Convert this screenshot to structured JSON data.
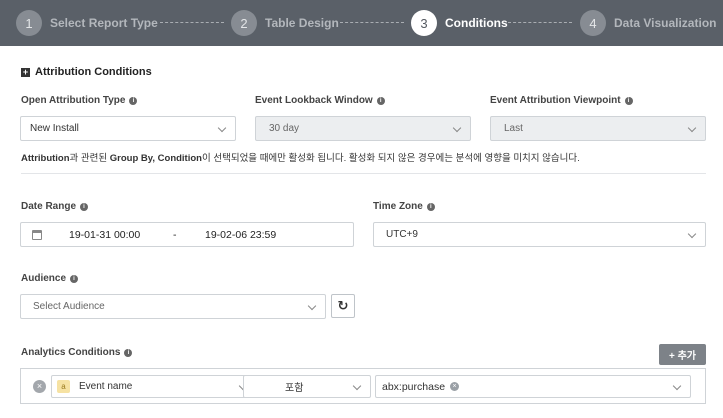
{
  "stepper": {
    "steps": [
      {
        "num": "1",
        "label": "Select Report Type"
      },
      {
        "num": "2",
        "label": "Table Design"
      },
      {
        "num": "3",
        "label": "Conditions"
      },
      {
        "num": "4",
        "label": "Data Visualization"
      }
    ],
    "active_step": 3
  },
  "section": {
    "icon": "plus-square-icon",
    "title": "Attribution Conditions"
  },
  "attribution": {
    "open_type": {
      "label": "Open Attribution Type",
      "value": "New Install"
    },
    "lookback": {
      "label": "Event Lookback Window",
      "value": "30 day"
    },
    "viewpoint": {
      "label": "Event Attribution Viewpoint",
      "value": "Last"
    },
    "note": {
      "part1": "Attribution",
      "part2": "과 관련된 ",
      "part3": "Group By, Condition",
      "part4": "이 선택되었을 때에만 활성화 됩니다. 활성화 되지 않은 경우에는 분석에 영향을 미치지 않습니다."
    }
  },
  "date_range": {
    "label": "Date Range",
    "start": "19-01-31 00:00",
    "separator": "-",
    "end": "19-02-06 23:59"
  },
  "timezone": {
    "label": "Time Zone",
    "value": "UTC+9"
  },
  "audience": {
    "label": "Audience",
    "placeholder": "Select Audience",
    "refresh_icon": "refresh-icon"
  },
  "analytics": {
    "label": "Analytics Conditions",
    "add_button": "+ 추가",
    "condition": {
      "type_badge": "a",
      "field": "Event name",
      "operator": "포함",
      "tag": "abx:purchase"
    }
  },
  "colors": {
    "header_bg": "#5a6068",
    "add_button_bg": "#7d8288",
    "disabled_bg": "#eceef0"
  }
}
